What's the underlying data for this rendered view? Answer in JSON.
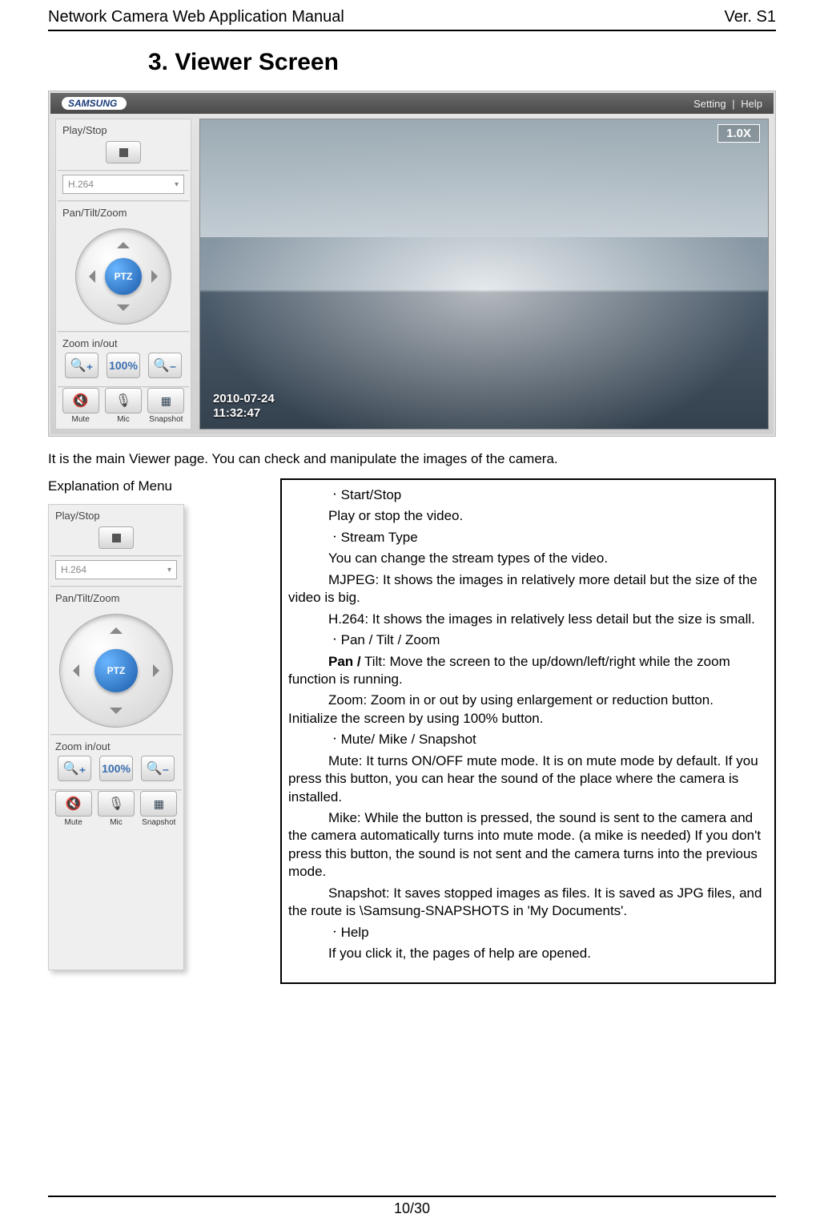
{
  "header": {
    "left": "Network Camera Web Application Manual",
    "right": "Ver. S1"
  },
  "section_title": "3. Viewer Screen",
  "topbar": {
    "brand": "SAMSUNG",
    "setting": "Setting",
    "sep": "|",
    "help": "Help"
  },
  "panel": {
    "play_label": "Play/Stop",
    "codec": "H.264",
    "ptz_label": "Pan/Tilt/Zoom",
    "ptz_center": "PTZ",
    "zoom_label": "Zoom in/out",
    "zoom_100": "100%",
    "mute": "Mute",
    "mic": "Mic",
    "snapshot": "Snapshot"
  },
  "video": {
    "zoom": "1.0X",
    "date": "2010-07-24",
    "time": "11:32:47"
  },
  "intro": "It is the main Viewer page. You can check and manipulate the images of the camera.",
  "menu_col_title": "Explanation of Menu",
  "desc": {
    "ss_h": "ㆍStart/Stop",
    "ss_b": "Play or stop the video.",
    "st_h": "ㆍStream Type",
    "st_1": "You can change the stream types of the video.",
    "st_2": "MJPEG: It shows the images in relatively more detail but the size of the video is big.",
    "st_3": "H.264: It shows the images in relatively less detail but the size is small.",
    "ptz_h_pre": "ㆍ",
    "ptz_h_pan": "Pan",
    "ptz_h_rest": " / Tilt / Zoom",
    "ptz_1_b": "Pan /",
    "ptz_1_r": " Tilt: Move the screen to the up/down/left/right while the zoom function is running.",
    "ptz_2": "Zoom: Zoom in or out by using enlargement or reduction button. Initialize the screen by using 100% button.",
    "mms_h": "ㆍMute/ Mike / Snapshot",
    "mms_1": "Mute: It turns ON/OFF mute mode. It is on mute mode by default. If you press this button, you can hear the sound of the place where the camera is installed.",
    "mms_2": "Mike: While the button is pressed, the sound is sent to the camera and the camera automatically turns into mute mode. (a mike is needed) If you don't press this button, the sound is not sent and the camera turns into the previous mode.",
    "mms_3": "Snapshot: It saves stopped images as files. It is saved as JPG files, and the route is \\Samsung-SNAPSHOTS in 'My Documents'.",
    "help_h": "ㆍHelp",
    "help_b": "If you click it, the pages of help are opened."
  },
  "footer": "10/30"
}
